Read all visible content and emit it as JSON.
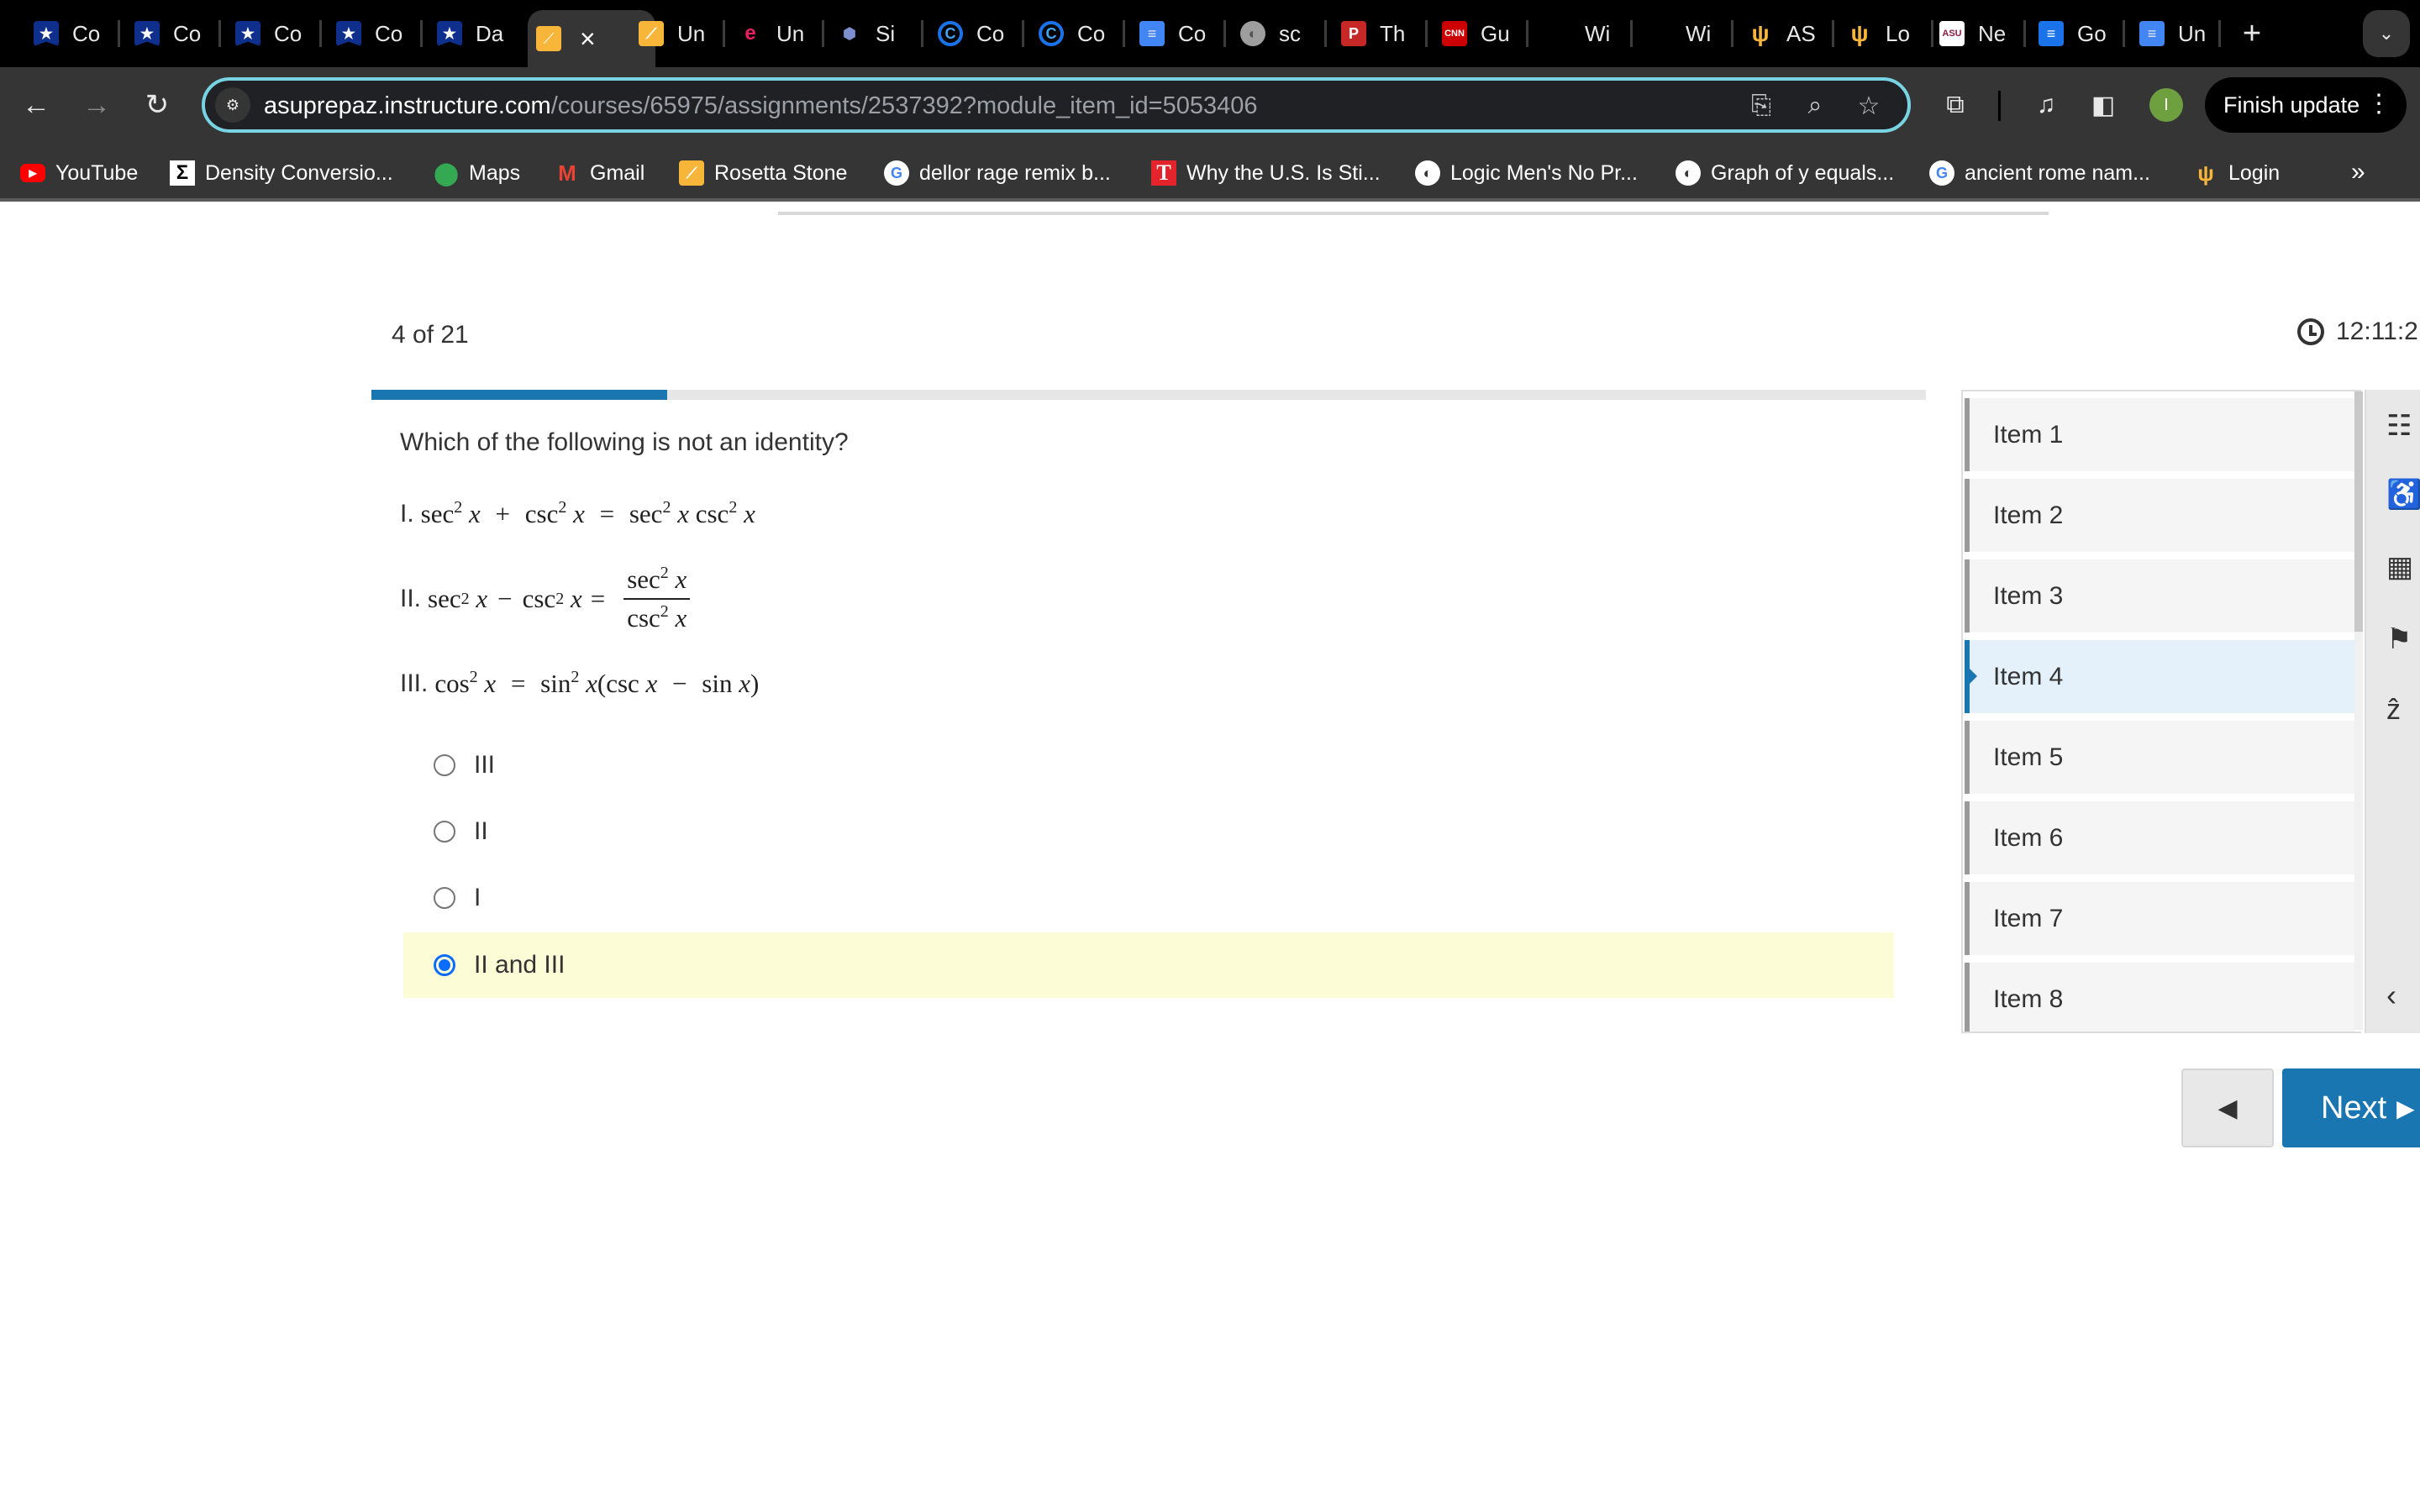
{
  "browser": {
    "tabs": [
      {
        "title": "Co",
        "icon": "star-shield-icon"
      },
      {
        "title": "Co",
        "icon": "star-shield-icon"
      },
      {
        "title": "Co",
        "icon": "star-shield-icon"
      },
      {
        "title": "Co",
        "icon": "star-shield-icon"
      },
      {
        "title": "Da",
        "icon": "star-shield-icon"
      },
      {
        "title": "",
        "icon": "rosetta-icon",
        "active": true
      },
      {
        "title": "Un",
        "icon": "rosetta-icon"
      },
      {
        "title": "Un",
        "icon": "rainbow-e-icon"
      },
      {
        "title": "Si",
        "icon": "hexagons-icon"
      },
      {
        "title": "Co",
        "icon": "c-circle-icon"
      },
      {
        "title": "Co",
        "icon": "c-circle-icon"
      },
      {
        "title": "Co",
        "icon": "doc-icon"
      },
      {
        "title": "sc",
        "icon": "globe-icon"
      },
      {
        "title": "Th",
        "icon": "p-icon"
      },
      {
        "title": "Gu",
        "icon": "cnn-icon"
      },
      {
        "title": "Wi",
        "icon": "blank-icon"
      },
      {
        "title": "Wi",
        "icon": "blank-icon"
      },
      {
        "title": "AS",
        "icon": "trident-icon"
      },
      {
        "title": "Lo",
        "icon": "trident-icon"
      },
      {
        "title": "Ne",
        "icon": "asu-icon"
      },
      {
        "title": "Go",
        "icon": "google-doc-icon"
      },
      {
        "title": "Un",
        "icon": "doc-icon"
      }
    ],
    "active_tab_close": "×",
    "new_tab": "+",
    "tab_search": "⌄",
    "url_host": "asuprepaz.instructure.com",
    "url_path": "/courses/65975/assignments/2537392?module_item_id=5053406",
    "profile_initial": "I",
    "finish_update": "Finish update",
    "bookmarks": [
      {
        "label": "YouTube",
        "icon": "youtube-icon",
        "glyph": "▶"
      },
      {
        "label": "Density Conversio...",
        "icon": "sigma-icon",
        "glyph": "Σ"
      },
      {
        "label": "Maps",
        "icon": "maps-pin-icon",
        "glyph": "⬤"
      },
      {
        "label": "Gmail",
        "icon": "gmail-icon",
        "glyph": "M"
      },
      {
        "label": "Rosetta Stone",
        "icon": "rosetta-icon",
        "glyph": "⟋"
      },
      {
        "label": "dellor rage remix b...",
        "icon": "google-icon",
        "glyph": "G"
      },
      {
        "label": "Why the U.S. Is Sti...",
        "icon": "t-icon",
        "glyph": "T"
      },
      {
        "label": "Logic Men's No Pr...",
        "icon": "globe-icon",
        "glyph": "◐"
      },
      {
        "label": "Graph of y equals...",
        "icon": "globe-icon",
        "glyph": "◐"
      },
      {
        "label": "ancient rome nam...",
        "icon": "google-icon",
        "glyph": "G"
      },
      {
        "label": "Login",
        "icon": "trident-icon",
        "glyph": "ψ"
      }
    ],
    "bookmarks_overflow": "»"
  },
  "quiz": {
    "counter": "4 of 21",
    "timer": "12:11:2",
    "progress": {
      "current": 4,
      "total": 21
    },
    "question": "Which of the following is not an identity?",
    "statements": [
      {
        "label": "I.",
        "parts": [
          "sec",
          "2",
          "x",
          "+",
          "csc",
          "2",
          "x",
          "=",
          "sec",
          "2",
          "x",
          "csc",
          "2",
          "x"
        ]
      },
      {
        "label": "II.",
        "lhs": [
          "sec",
          "2",
          "x",
          "−",
          "csc",
          "2",
          "x",
          "="
        ],
        "numerator": [
          "sec",
          "2",
          "x"
        ],
        "denominator": [
          "csc",
          "2",
          "x"
        ]
      },
      {
        "label": "III.",
        "parts": [
          "cos",
          "2",
          "x",
          "=",
          "sin",
          "2",
          "x",
          "(csc",
          "x",
          "−",
          "sin",
          "x",
          ")"
        ]
      }
    ],
    "choices": [
      {
        "label": "III",
        "selected": false
      },
      {
        "label": "II",
        "selected": false
      },
      {
        "label": "I",
        "selected": false
      },
      {
        "label": "II and III",
        "selected": true
      }
    ],
    "items": [
      {
        "label": "Item 1"
      },
      {
        "label": "Item 2"
      },
      {
        "label": "Item 3"
      },
      {
        "label": "Item 4",
        "current": true
      },
      {
        "label": "Item 5"
      },
      {
        "label": "Item 6"
      },
      {
        "label": "Item 7"
      },
      {
        "label": "Item 8"
      }
    ],
    "tools": [
      "item-list-icon",
      "accessibility-icon",
      "calculator-icon",
      "flag-icon",
      "strikethrough-icon"
    ],
    "collapse_glyph": "‹",
    "prev_glyph": "◀",
    "next_label": "Next",
    "next_glyph": "▶"
  },
  "colors": {
    "accent": "#1a76b1",
    "selected_choice_bg": "#fcfcd6",
    "current_item_bg": "#e4f1fb",
    "radio_selected": "#0a6cff",
    "omnibox_focus": "#78d3e2"
  }
}
